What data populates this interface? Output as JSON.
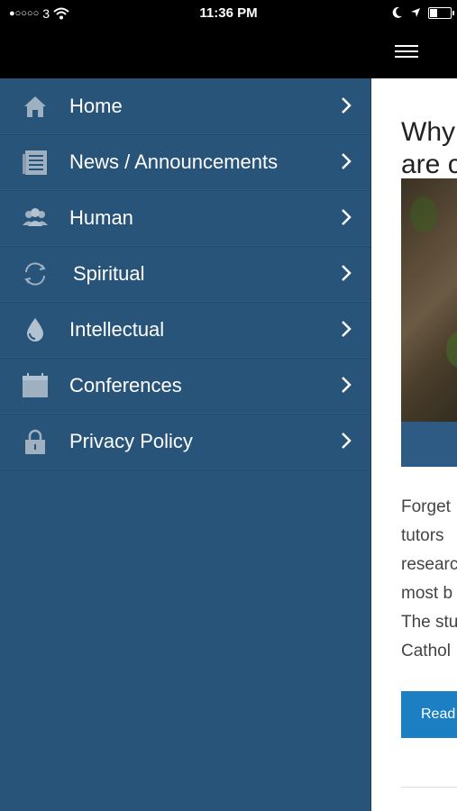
{
  "status_bar": {
    "carrier": "3",
    "time": "11:36 PM"
  },
  "menu": {
    "items": [
      {
        "label": "Home",
        "icon": "home-icon"
      },
      {
        "label": "News / Announcements",
        "icon": "document-icon"
      },
      {
        "label": "Human",
        "icon": "people-icon"
      },
      {
        "label": "Spiritual",
        "icon": "cycle-icon"
      },
      {
        "label": "Intellectual",
        "icon": "drop-icon"
      },
      {
        "label": "Conferences",
        "icon": "calendar-icon"
      },
      {
        "label": "Privacy Policy",
        "icon": "lock-icon"
      }
    ]
  },
  "article": {
    "title": "Why\nare c",
    "body_lines": [
      "Forget",
      "tutors",
      "researc",
      "most b",
      "The stu",
      "Cathol"
    ],
    "button_label": "Read"
  },
  "colors": {
    "menu_background": "#285479",
    "button_blue": "#1c7fc4",
    "caption_bar": "#2e5b84"
  }
}
